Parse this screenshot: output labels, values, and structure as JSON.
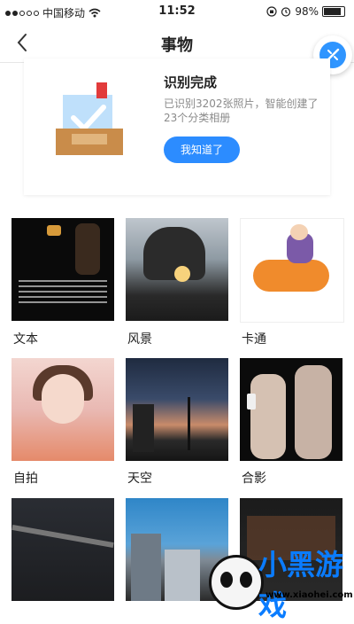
{
  "status_bar": {
    "carrier": "中国移动",
    "time": "11:52",
    "battery": "98%"
  },
  "nav": {
    "title": "事物"
  },
  "notice_card": {
    "title": "识别完成",
    "description": "已识别3202张照片，智能创建了23个分类相册",
    "button_label": "我知道了"
  },
  "categories": [
    {
      "label": "文本"
    },
    {
      "label": "风景"
    },
    {
      "label": "卡通"
    },
    {
      "label": "自拍"
    },
    {
      "label": "天空"
    },
    {
      "label": "合影"
    },
    {
      "label": ""
    },
    {
      "label": ""
    },
    {
      "label": ""
    }
  ],
  "watermark": {
    "brand": "小黑游戏",
    "url": "www.xiaohei.com"
  },
  "colors": {
    "accent": "#2c8cff",
    "muted_text": "#8a8a8a"
  }
}
